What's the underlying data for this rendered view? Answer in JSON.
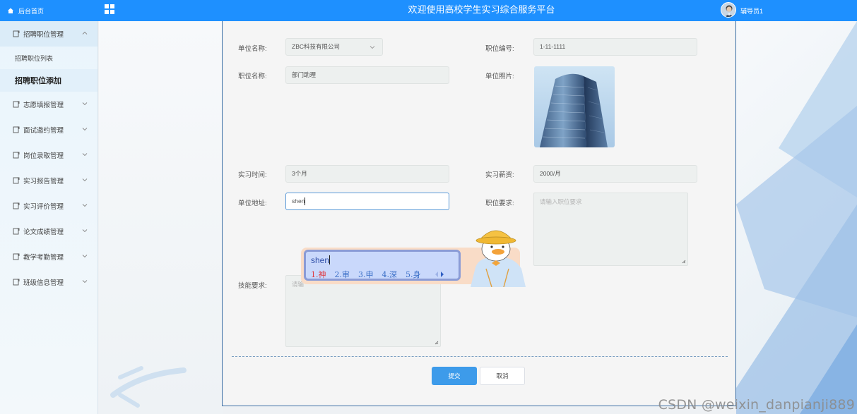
{
  "header": {
    "home_label": "后台首页",
    "title": "欢迎使用高校学生实习综合服务平台",
    "user_name": "辅导员1"
  },
  "sidebar": {
    "items": [
      {
        "label": "招聘职位管理"
      },
      {
        "label": "志愿填报管理"
      },
      {
        "label": "面试邀约管理"
      },
      {
        "label": "岗位录取管理"
      },
      {
        "label": "实习报告管理"
      },
      {
        "label": "实习评价管理"
      },
      {
        "label": "论文成绩管理"
      },
      {
        "label": "教学考勤管理"
      },
      {
        "label": "班级信息管理"
      }
    ],
    "sub_items": [
      {
        "label": "招聘职位列表"
      },
      {
        "label": "招聘职位添加"
      }
    ]
  },
  "form": {
    "company_label": "单位名称:",
    "company_value": "ZBC科技有限公司",
    "job_no_label": "职位编号:",
    "job_no_value": "1-11-1111",
    "job_name_label": "职位名称:",
    "job_name_value": "部门助理",
    "photo_label": "单位照片:",
    "period_label": "实习时间:",
    "period_value": "3个月",
    "salary_label": "实习薪资:",
    "salary_value": "2000/月",
    "address_label": "单位地址:",
    "address_value": "shen",
    "requirement_label": "职位要求:",
    "requirement_placeholder": "请输入职位要求",
    "skill_label": "技能要求:",
    "skill_placeholder": "请输",
    "submit_label": "提交",
    "cancel_label": "取消"
  },
  "ime": {
    "input": "shen",
    "candidates": [
      "1.神",
      "2.审",
      "3.申",
      "4.深",
      "5.身"
    ]
  },
  "watermark": "CSDN @weixin_danpianji889",
  "colors": {
    "header_bg": "#1e90ff",
    "submit_bg": "#3d9bea",
    "panel_border": "#3a6ea5"
  }
}
